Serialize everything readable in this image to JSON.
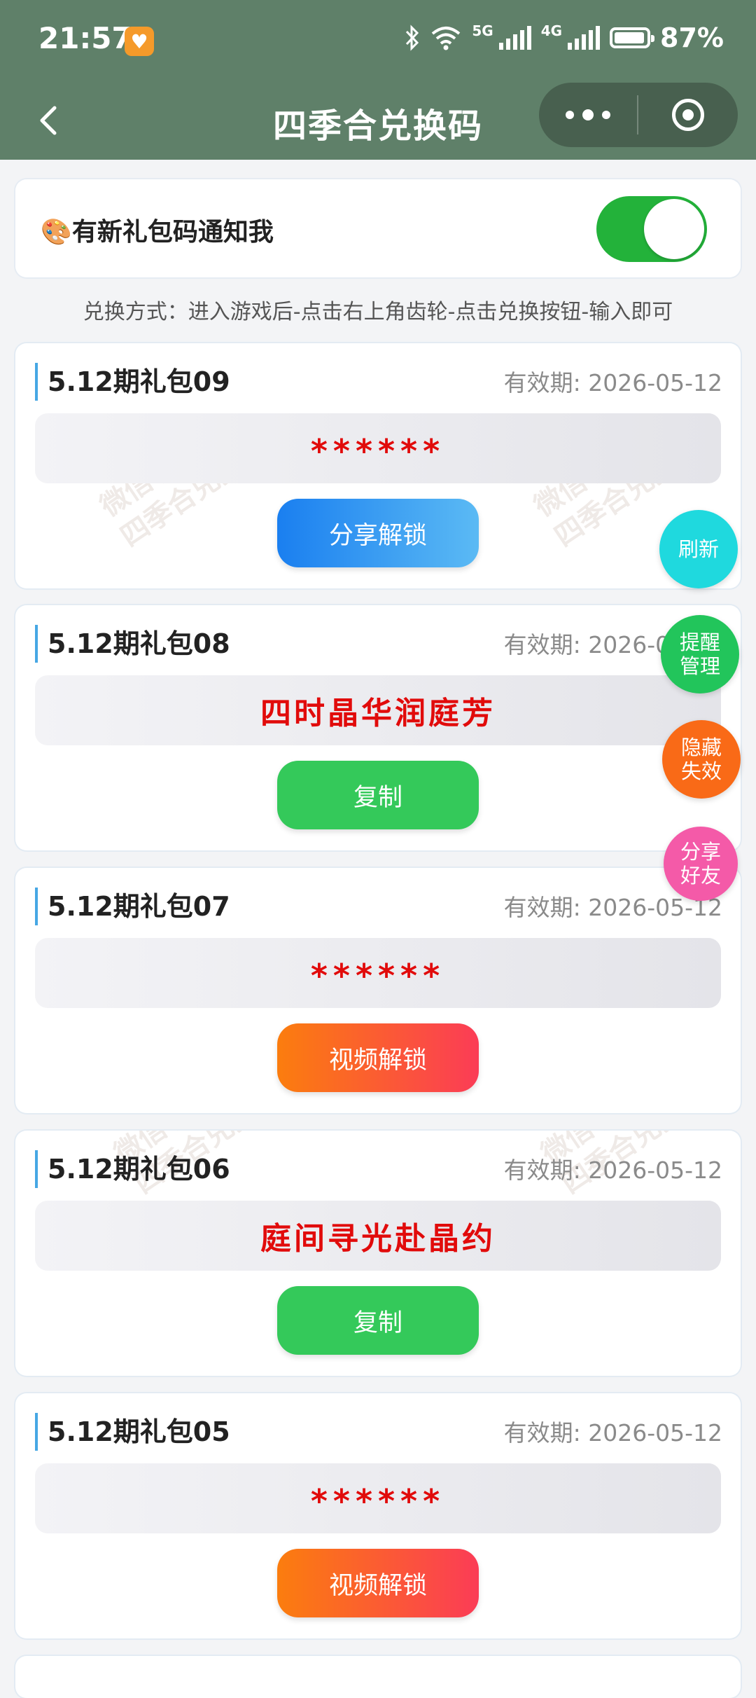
{
  "status": {
    "time": "21:57",
    "net_5g": "5G",
    "net_4g": "4G",
    "battery": "87%",
    "battery_level": 0.87
  },
  "nav": {
    "title": "四季合兑换码"
  },
  "notify": {
    "emoji": "🎨",
    "label": "有新礼包码通知我",
    "enabled": true
  },
  "method": "兑换方式：进入游戏后-点击右上角齿轮-点击兑换按钮-输入即可",
  "cards": [
    {
      "title": "5.12期礼包09",
      "date": "有效期: 2026-05-12",
      "code": "******",
      "button": "分享解锁"
    },
    {
      "title": "5.12期礼包08",
      "date": "有效期: 2026-05-12",
      "code": "四时晶华润庭芳",
      "button": "复制"
    },
    {
      "title": "5.12期礼包07",
      "date": "有效期: 2026-05-12",
      "code": "******",
      "button": "视频解锁"
    },
    {
      "title": "5.12期礼包06",
      "date": "有效期: 2026-05-12",
      "code": "庭间寻光赴晶约",
      "button": "复制"
    },
    {
      "title": "5.12期礼包05",
      "date": "有效期: 2026-05-12",
      "code": "******",
      "button": "视频解锁"
    }
  ],
  "floats": {
    "refresh": "刷新",
    "remind": "提醒管理",
    "hide": "隐藏失效",
    "share": "分享好友"
  },
  "watermark": {
    "line1": "微信小程序",
    "line2": "四季合兑换码"
  },
  "colors": {
    "nav_bg": "#5f8069",
    "toggle_on": "#23b23a",
    "code_red": "#e10b0b",
    "accent_blue": "#46a7e4"
  }
}
